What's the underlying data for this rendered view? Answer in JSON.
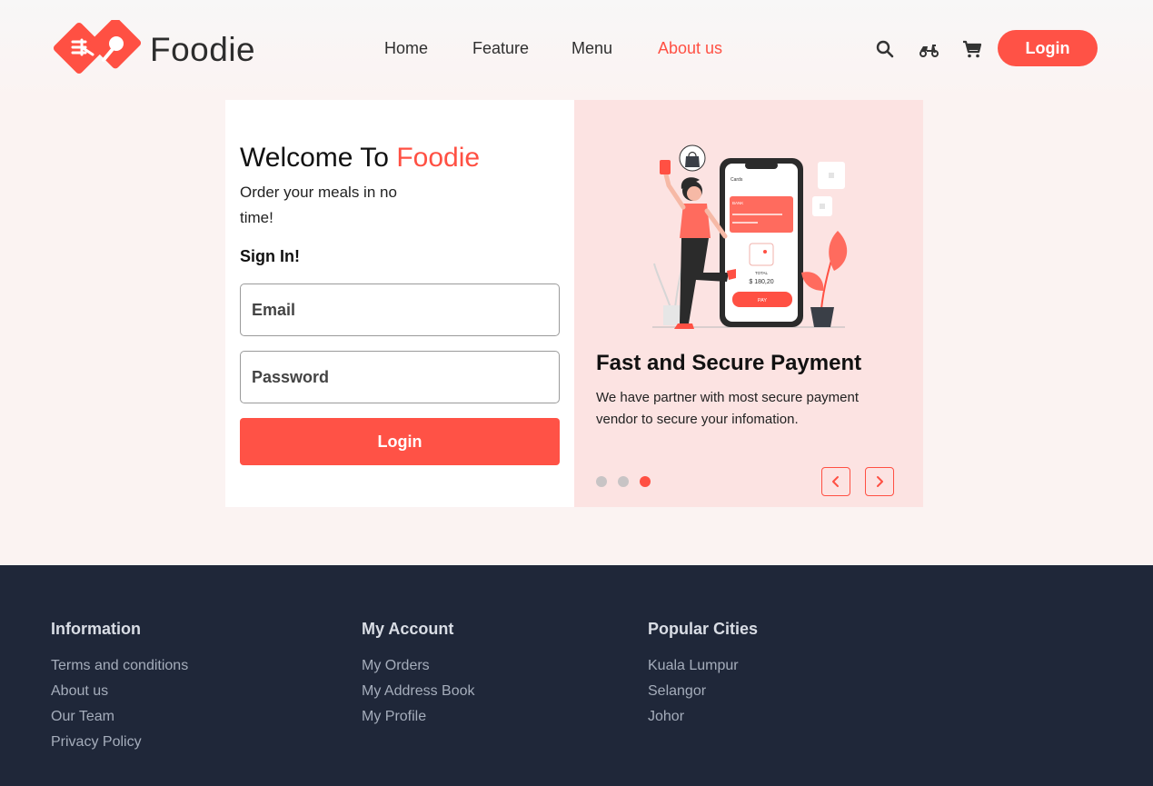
{
  "header": {
    "logo_text": "Foodie",
    "nav": [
      {
        "label": "Home",
        "active": false
      },
      {
        "label": "Feature",
        "active": false
      },
      {
        "label": "Menu",
        "active": false
      },
      {
        "label": "About us",
        "active": true
      }
    ],
    "icons": [
      "search-icon",
      "delivery-scooter-icon",
      "cart-icon"
    ],
    "login_label": "Login"
  },
  "login": {
    "welcome_prefix": "Welcome To",
    "welcome_brand": "Foodie",
    "subtitle": "Order your meals in no time!",
    "signin_label": "Sign In!",
    "email_placeholder": "Email",
    "password_placeholder": "Password",
    "submit_label": "Login"
  },
  "carousel": {
    "slide_title": "Fast and Secure Payment",
    "slide_text": "We have partner with most secure payment vendor to secure your infomation.",
    "dot_count": 3,
    "active_index": 2,
    "phone_screen": {
      "header": "Cards",
      "card_label": "BANK",
      "total_label": "TOTAL",
      "total_value": "$ 180,20",
      "pay_label": "PAY"
    }
  },
  "footer": {
    "columns": [
      {
        "title": "Information",
        "links": [
          "Terms and conditions",
          "About us",
          "Our Team",
          "Privacy Policy"
        ]
      },
      {
        "title": "My Account",
        "links": [
          "My Orders",
          "My Address Book",
          "My Profile"
        ]
      },
      {
        "title": "Popular Cities",
        "links": [
          "Kuala Lumpur",
          "Selangor",
          "Johor"
        ]
      }
    ]
  },
  "colors": {
    "accent": "#ff5043",
    "footer_bg": "#1f2739",
    "carousel_bg": "#fce3e2",
    "page_bg": "#fbf3f2"
  }
}
